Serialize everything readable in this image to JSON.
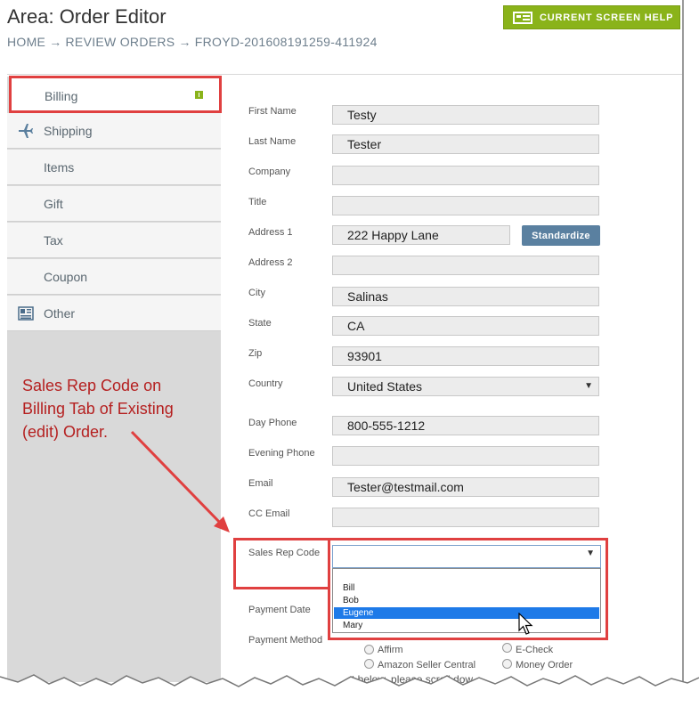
{
  "header": {
    "title": "Area: Order Editor",
    "breadcrumbs": [
      "HOME",
      "REVIEW ORDERS",
      "FROYD-201608191259-411924"
    ],
    "separator": "→",
    "help_button": "CURRENT SCREEN HELP"
  },
  "sidebar": {
    "items": [
      {
        "label": "Billing",
        "icon": "badge-icon"
      },
      {
        "label": "Shipping",
        "icon": "airplane-icon"
      },
      {
        "label": "Items",
        "icon": ""
      },
      {
        "label": "Gift",
        "icon": ""
      },
      {
        "label": "Tax",
        "icon": ""
      },
      {
        "label": "Coupon",
        "icon": ""
      },
      {
        "label": "Other",
        "icon": "newspaper-icon"
      }
    ]
  },
  "annotation": {
    "lines": [
      "Sales Rep Code on",
      "Billing Tab of Existing",
      "(edit) Order."
    ]
  },
  "form": {
    "first_name": {
      "label": "First Name",
      "value": "Testy"
    },
    "last_name": {
      "label": "Last Name",
      "value": "Tester"
    },
    "company": {
      "label": "Company",
      "value": ""
    },
    "title": {
      "label": "Title",
      "value": ""
    },
    "address1": {
      "label": "Address 1",
      "value": "222 Happy Lane"
    },
    "standardize": "Standardize",
    "address2": {
      "label": "Address 2",
      "value": ""
    },
    "city": {
      "label": "City",
      "value": "Salinas"
    },
    "state": {
      "label": "State",
      "value": "CA"
    },
    "zip": {
      "label": "Zip",
      "value": "93901"
    },
    "country": {
      "label": "Country",
      "value": "United States"
    },
    "day_phone": {
      "label": "Day Phone",
      "value": "800-555-1212"
    },
    "evening_phone": {
      "label": "Evening Phone",
      "value": ""
    },
    "email": {
      "label": "Email",
      "value": "Tester@testmail.com"
    },
    "cc_email": {
      "label": "CC Email",
      "value": ""
    },
    "sales_rep": {
      "label": "Sales Rep Code",
      "value": "",
      "options": [
        "Bill",
        "Bob",
        "Eugene",
        "Mary"
      ],
      "highlighted": "Eugene"
    },
    "payment_date": {
      "label": "Payment Date"
    },
    "payment_method": {
      "label": "Payment Method",
      "options": [
        "Affirm",
        "E-Check",
        "Amazon Seller Central",
        "Money Order"
      ]
    },
    "notice": "t below, please scroll dow"
  },
  "colors": {
    "accent_green": "#8ab31a",
    "annotation_red": "#e04040",
    "button_blue": "#5a80a0",
    "highlight_blue": "#1e7ae8"
  }
}
